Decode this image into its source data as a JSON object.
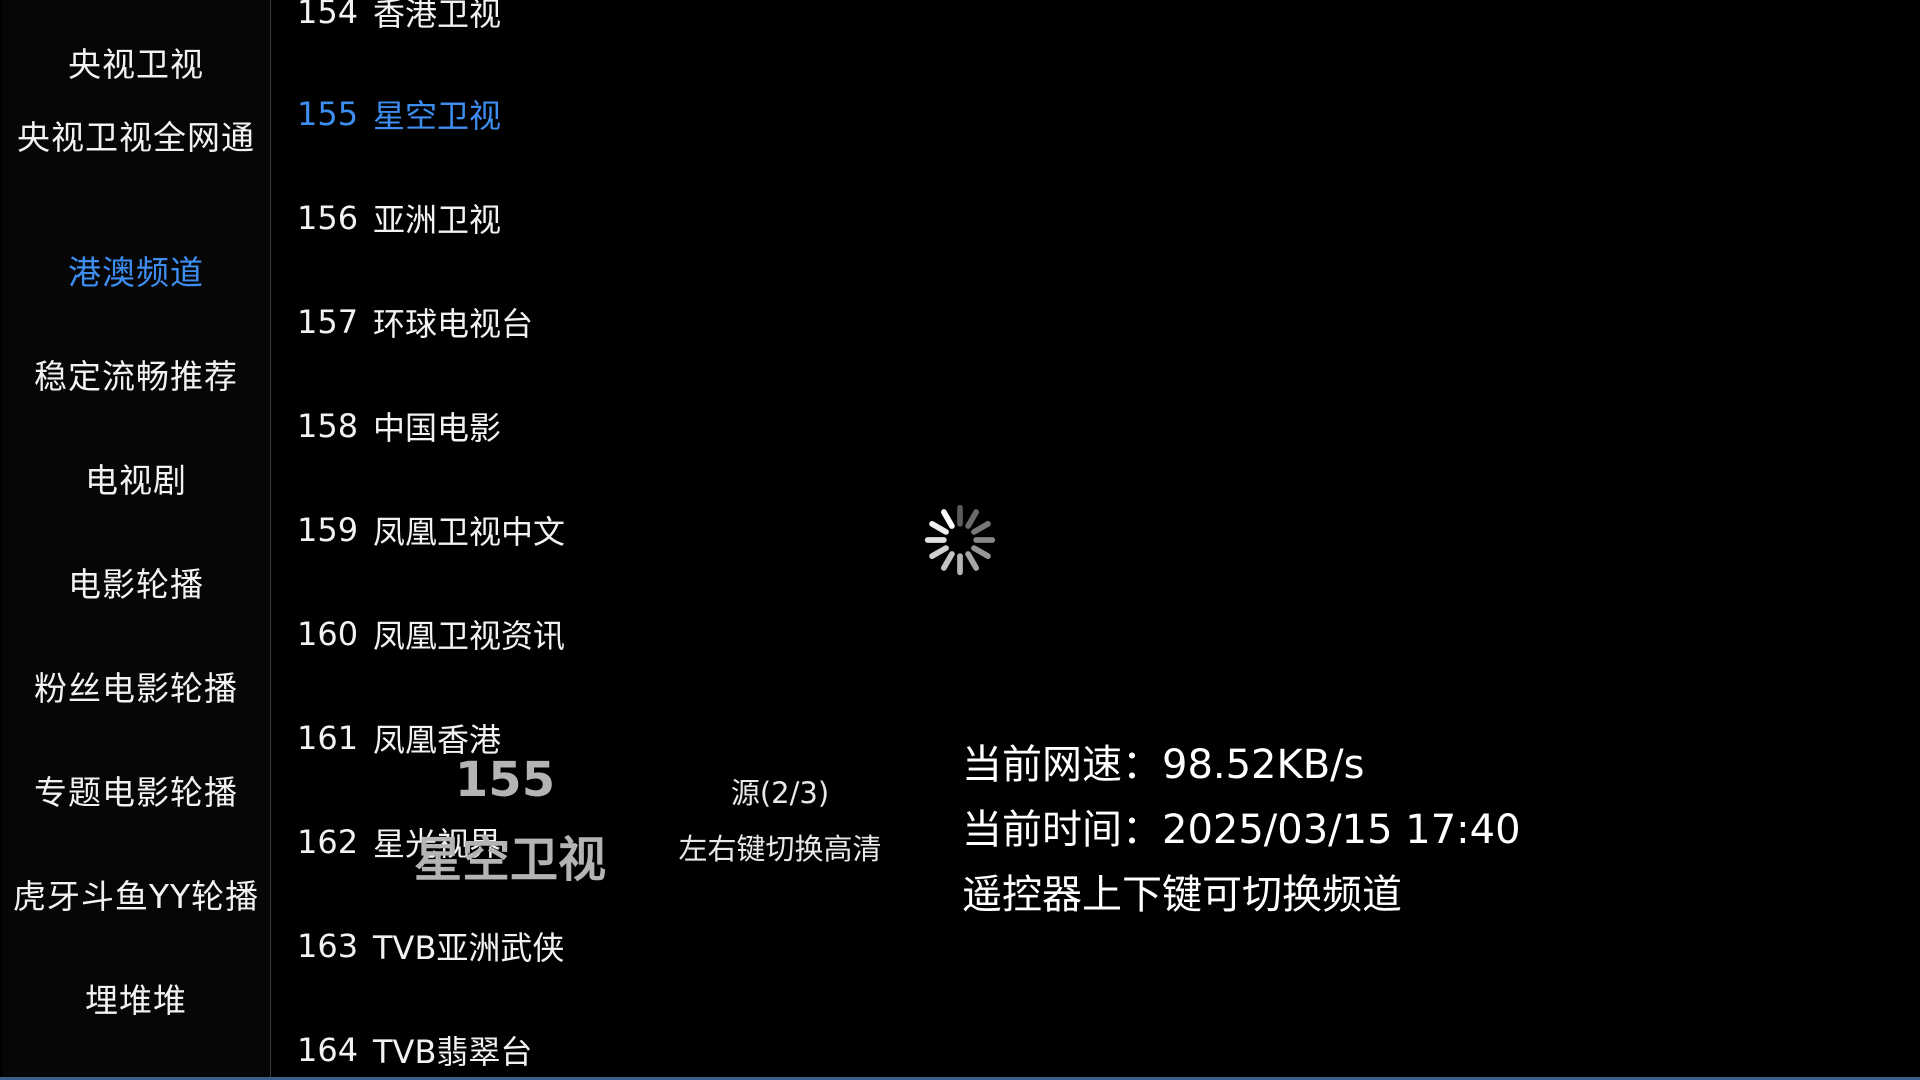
{
  "sidebar": {
    "items": [
      {
        "label": "央视卫视",
        "active": false
      },
      {
        "label": "央视卫视全网通",
        "active": false
      },
      {
        "label": "港澳频道",
        "active": true
      },
      {
        "label": "稳定流畅推荐",
        "active": false
      },
      {
        "label": "电视剧",
        "active": false
      },
      {
        "label": "电影轮播",
        "active": false
      },
      {
        "label": "粉丝电影轮播",
        "active": false
      },
      {
        "label": "专题电影轮播",
        "active": false
      },
      {
        "label": "虎牙斗鱼YY轮播",
        "active": false
      },
      {
        "label": "埋堆堆",
        "active": false
      }
    ]
  },
  "channels": [
    {
      "number": "154",
      "name": "香港卫视",
      "active": false
    },
    {
      "number": "155",
      "name": "星空卫视",
      "active": true
    },
    {
      "number": "156",
      "name": "亚洲卫视",
      "active": false
    },
    {
      "number": "157",
      "name": "环球电视台",
      "active": false
    },
    {
      "number": "158",
      "name": "中国电影",
      "active": false
    },
    {
      "number": "159",
      "name": "凤凰卫视中文",
      "active": false
    },
    {
      "number": "160",
      "name": "凤凰卫视资讯",
      "active": false
    },
    {
      "number": "161",
      "name": "凤凰香港",
      "active": false
    },
    {
      "number": "162",
      "name": "星光视界",
      "active": false
    },
    {
      "number": "163",
      "name": "TVB亚洲武侠",
      "active": false
    },
    {
      "number": "164",
      "name": "TVB翡翠台",
      "active": false
    }
  ],
  "now_playing": {
    "number": "155",
    "name": "星空卫视",
    "source": "源(2/3)",
    "source_hint": "左右键切换高清"
  },
  "info": {
    "speed": "当前网速：98.52KB/s",
    "time": "当前时间：2025/03/15 17:40",
    "hint": "遥控器上下键可切换频道"
  },
  "colors": {
    "accent": "#3d8ef0",
    "text": "#f2f2f2",
    "background": "#000000",
    "overlay_text": "#b4b4b4"
  },
  "icons": {
    "spinner": "loading-spinner-icon"
  }
}
